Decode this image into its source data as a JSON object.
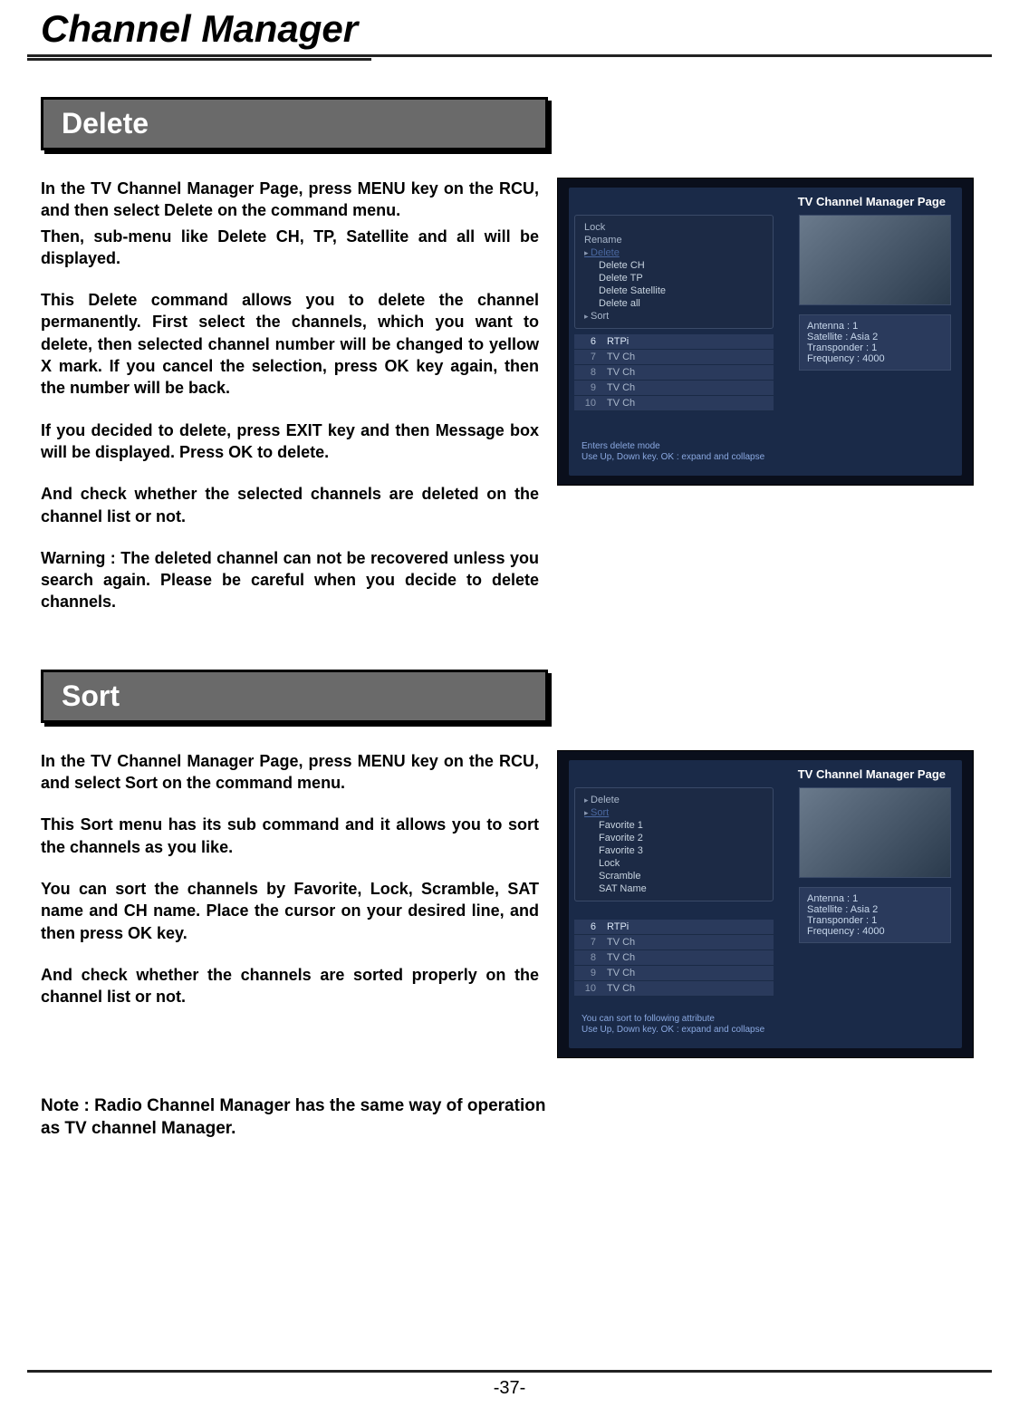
{
  "page": {
    "title": "Channel Manager",
    "number": "-37-"
  },
  "sections": {
    "delete": {
      "header": "Delete",
      "p1": "In the TV Channel Manager Page, press MENU key on the RCU, and then select Delete on the command menu.",
      "p2": "Then, sub-menu like Delete CH, TP, Satellite and all will be displayed.",
      "p3": "This Delete command allows you to delete the channel permanently. First select the channels, which you want to delete, then selected channel number will be changed to yellow X mark. If you cancel the selection, press OK key again, then the number will be back.",
      "p4": "If you decided to delete, press EXIT key and then Message box will be displayed. Press OK to delete.",
      "p5": "And check whether the selected channels are deleted on the channel list or not.",
      "p6": "Warning : The deleted channel can not be recovered unless you search again. Please be careful when you decide to delete channels."
    },
    "sort": {
      "header": "Sort",
      "p1": "In the TV Channel Manager Page, press MENU key on the RCU, and select Sort on the command menu.",
      "p2": "This Sort menu has its sub command and it allows you to sort the channels as you like.",
      "p3": "You can sort the channels by Favorite, Lock, Scramble, SAT name and CH name. Place the cursor on your desired line, and then press OK key.",
      "p4": "And check whether the channels are sorted properly on the channel list or not."
    }
  },
  "note": "Note : Radio Channel Manager has the same way of operation as TV channel Manager.",
  "tv": {
    "title": "TV Channel Manager Page",
    "delete_menu": {
      "items": [
        "Lock",
        "Rename",
        "Delete"
      ],
      "sub": [
        "Delete CH",
        "Delete TP",
        "Delete Satellite",
        "Delete all"
      ],
      "tail": "Sort"
    },
    "sort_menu": {
      "items": [
        "Delete",
        "Sort"
      ],
      "sub": [
        "Favorite 1",
        "Favorite 2",
        "Favorite 3",
        "Lock",
        "Scramble",
        "SAT Name"
      ]
    },
    "channels": [
      {
        "n": "6",
        "name": "RTPi"
      },
      {
        "n": "7",
        "name": "TV Ch"
      },
      {
        "n": "8",
        "name": "TV Ch"
      },
      {
        "n": "9",
        "name": "TV Ch"
      },
      {
        "n": "10",
        "name": "TV Ch"
      }
    ],
    "info": {
      "l1": "Antenna : 1",
      "l2": "Satellite : Asia 2",
      "l3": "Transponder : 1",
      "l4": "Frequency : 4000"
    },
    "status_delete": {
      "l1": "Enters delete mode",
      "l2": "Use Up, Down key. OK : expand and collapse"
    },
    "status_sort": {
      "l1": "You can sort to following attribute",
      "l2": "Use Up, Down key. OK : expand and collapse"
    }
  }
}
